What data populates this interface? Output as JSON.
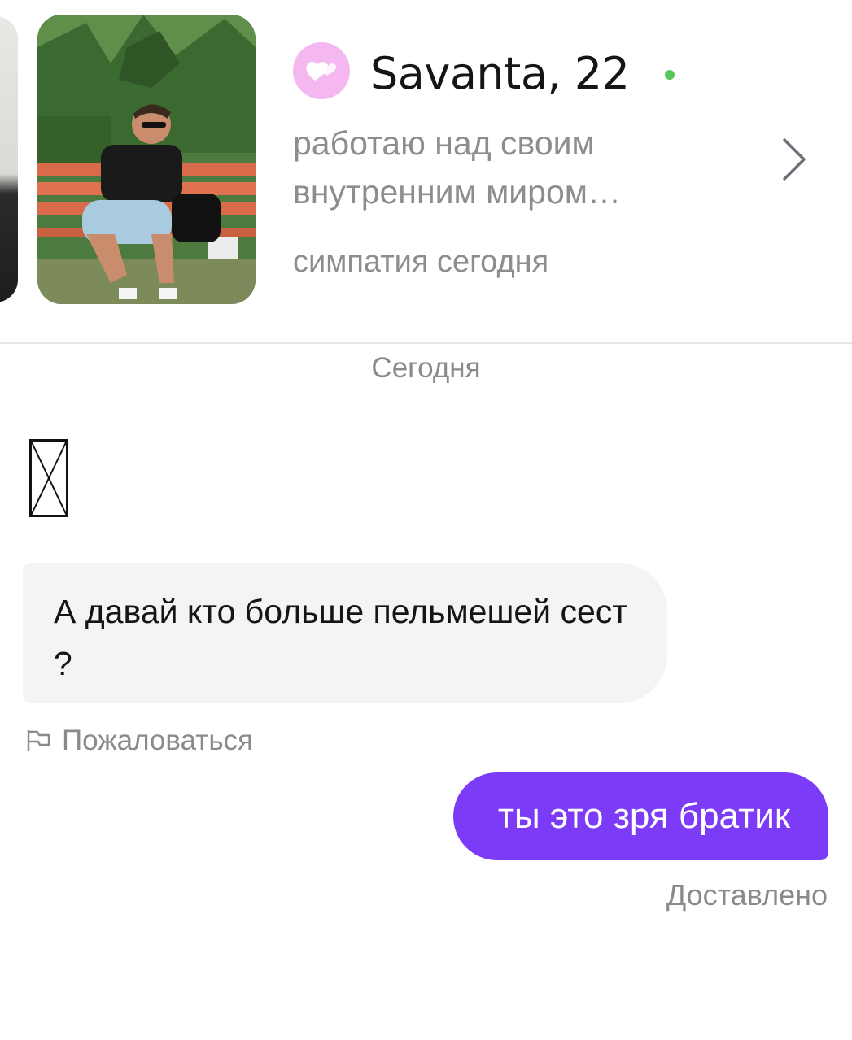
{
  "colors": {
    "accent": "#7c3bf6",
    "online": "#5cc55a",
    "badge": "#f4b7ef",
    "incoming_bubble": "#f4f4f4"
  },
  "profile": {
    "name_age": "Savanta, 22",
    "bio": "работаю над своим внутренним миром…",
    "match_status": "симпатия сегодня",
    "badge_icon": "hearts-icon",
    "online": true
  },
  "chat": {
    "date_separator": "Сегодня",
    "messages": [
      {
        "direction": "incoming",
        "text": "А давай кто больше пельмешей сест ?"
      },
      {
        "direction": "outgoing",
        "text": "ты это зря братик"
      }
    ],
    "report_label": "Пожаловаться",
    "delivery_status": "Доставлено"
  }
}
